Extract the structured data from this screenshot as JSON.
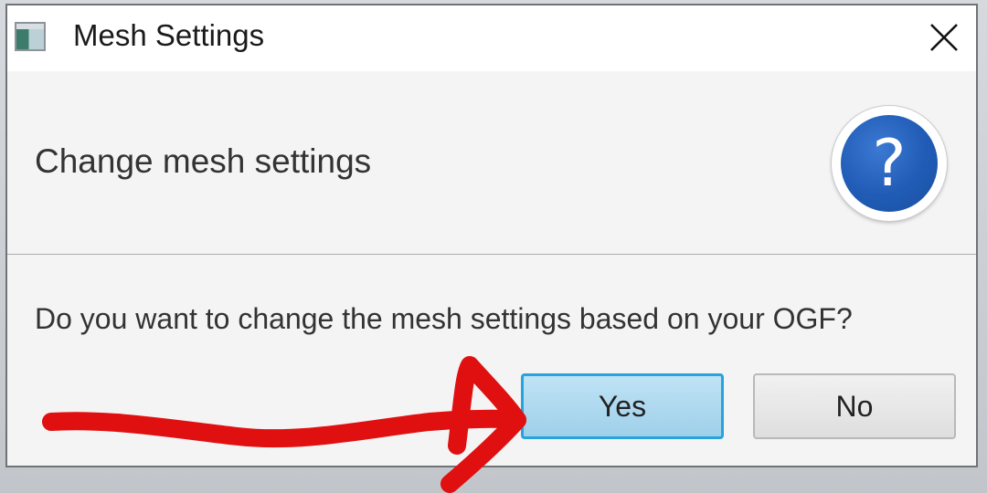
{
  "window": {
    "title": "Mesh Settings",
    "close_glyph": "✕"
  },
  "header": {
    "text": "Change mesh settings",
    "icon_glyph": "?"
  },
  "message": "Do you want to change the mesh settings based on your OGF?",
  "buttons": {
    "yes_label": "Yes",
    "no_label": "No"
  },
  "icons": {
    "app": "app-window-icon",
    "close": "close-icon",
    "help": "question-mark-icon",
    "annotation": "red-arrow-annotation"
  },
  "colors": {
    "accent": "#27a3dd",
    "help_blue": "#205cb6",
    "annotation_red": "#e01010"
  }
}
